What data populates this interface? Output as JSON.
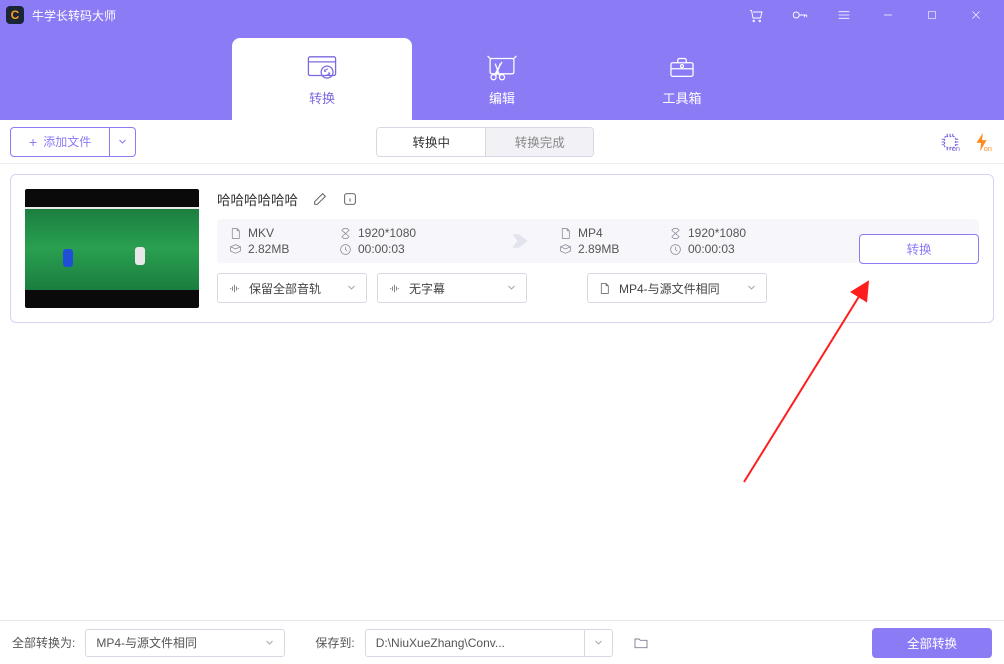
{
  "window": {
    "title": "牛学长转码大师"
  },
  "tabs": {
    "convert": "转换",
    "edit": "编辑",
    "toolbox": "工具箱"
  },
  "toolbar": {
    "add_file": "添加文件",
    "seg_converting": "转换中",
    "seg_done": "转换完成"
  },
  "file": {
    "name": "哈哈哈哈哈哈",
    "src": {
      "container": "MKV",
      "resolution": "1920*1080",
      "size": "2.82MB",
      "duration": "00:00:03"
    },
    "dst": {
      "container": "MP4",
      "resolution": "1920*1080",
      "size": "2.89MB",
      "duration": "00:00:03"
    },
    "audio_option": "保留全部音轨",
    "subtitle_option": "无字幕",
    "format_option": "MP4-与源文件相同",
    "convert_btn": "转换"
  },
  "footer": {
    "all_convert_to_label": "全部转换为:",
    "all_format": "MP4-与源文件相同",
    "save_to_label": "保存到:",
    "save_path": "D:\\NiuXueZhang\\Conv...",
    "all_convert_btn": "全部转换"
  }
}
